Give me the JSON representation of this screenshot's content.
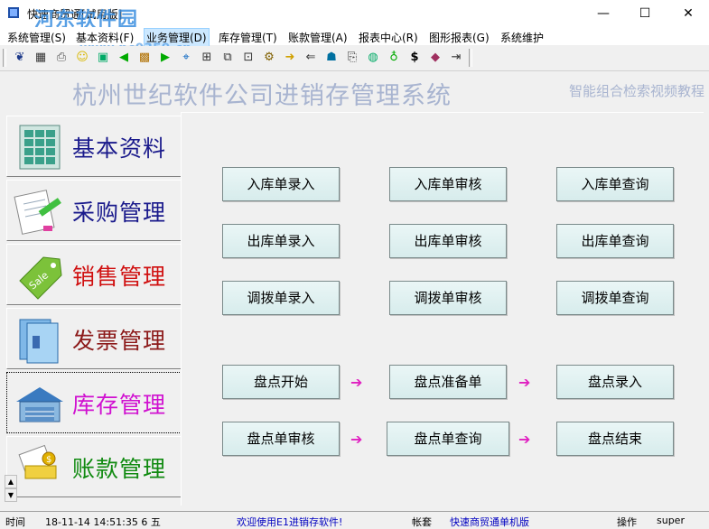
{
  "window": {
    "title": "快速商贸通[试用版]",
    "watermark": "河东软件园",
    "watermark_url": "www.pc0359.cn",
    "minimize": "—",
    "maximize": "☐",
    "close": "✕"
  },
  "menu": [
    {
      "label": "系统管理(S)"
    },
    {
      "label": "基本资料(F)"
    },
    {
      "label": "业务管理(D)"
    },
    {
      "label": "库存管理(T)"
    },
    {
      "label": "账款管理(A)"
    },
    {
      "label": "报表中心(R)"
    },
    {
      "label": "图形报表(G)"
    },
    {
      "label": "系统维护"
    }
  ],
  "toolbar_icons": [
    "bird-icon",
    "calculator-icon",
    "printer-icon",
    "smiley-icon",
    "stamp-icon",
    "back-icon",
    "box-icon",
    "forward-icon",
    "satellite-icon",
    "tree-icon",
    "copy-icon",
    "cart-icon",
    "export-icon",
    "import-icon",
    "person-icon",
    "stack-icon",
    "clip-icon",
    "money-bag-icon",
    "dollar-icon",
    "book-icon",
    "exit-icon"
  ],
  "banner": {
    "title": "杭州世纪软件公司进销存管理系统",
    "marquee": "智能组合检索视频教程"
  },
  "nav": [
    {
      "label": "基本资料",
      "color": "#1a1a8c",
      "icon": "grid-document-icon"
    },
    {
      "label": "采购管理",
      "color": "#1a1a8c",
      "icon": "notepad-pen-icon"
    },
    {
      "label": "销售管理",
      "color": "#d01010",
      "icon": "sale-tag-icon"
    },
    {
      "label": "发票管理",
      "color": "#8c1a1a",
      "icon": "folder-icon"
    },
    {
      "label": "库存管理",
      "color": "#d010d0",
      "icon": "warehouse-icon"
    },
    {
      "label": "账款管理",
      "color": "#108a10",
      "icon": "coins-icon"
    }
  ],
  "buttons": {
    "r1": [
      "入库单录入",
      "入库单审核",
      "入库单查询"
    ],
    "r2": [
      "出库单录入",
      "出库单审核",
      "出库单查询"
    ],
    "r3": [
      "调拨单录入",
      "调拨单审核",
      "调拨单查询"
    ],
    "r4": [
      "盘点开始",
      "盘点准备单",
      "盘点录入"
    ],
    "r5": [
      "盘点单审核",
      "盘点单查询",
      "盘点结束"
    ]
  },
  "arrow_glyph": "➔",
  "status": {
    "time_label": "时间",
    "time_value": "18-11-14 14:51:35 6 五",
    "welcome": "欢迎使用E1进销存软件!",
    "account_label": "帐套",
    "account_value": "快速商贸通单机版",
    "operator_label": "操作",
    "operator_value": "super"
  }
}
